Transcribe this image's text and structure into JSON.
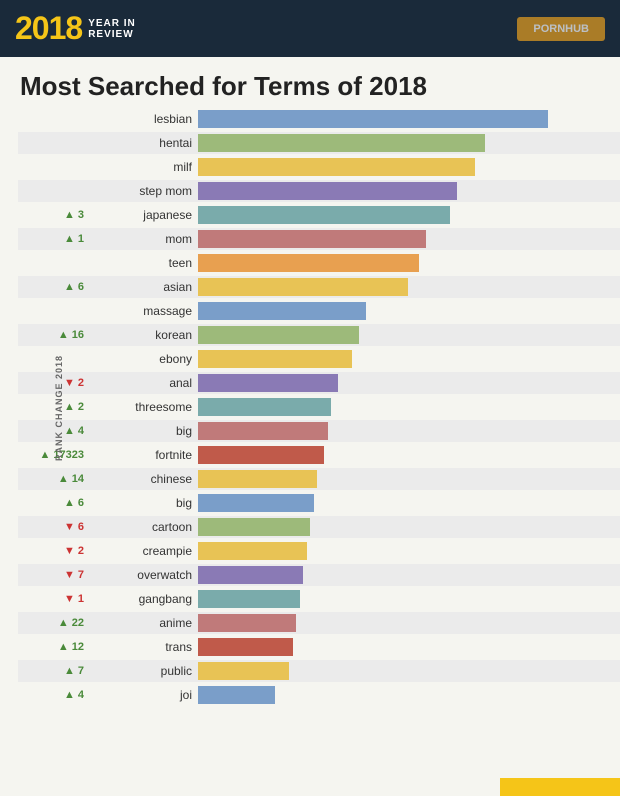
{
  "header": {
    "year": "2018",
    "tagline1": "YEAR IN",
    "tagline2": "REVIEW",
    "button_label": "PORNHUB"
  },
  "title": "Most Searched for Terms of 2018",
  "y_axis_label": "RANK CHANGE 2018",
  "bars": [
    {
      "label": "lesbian",
      "rank_change": "",
      "direction": "none",
      "value": 100,
      "color": "#7a9ec9"
    },
    {
      "label": "hentai",
      "rank_change": "",
      "direction": "none",
      "value": 82,
      "color": "#9dba7a"
    },
    {
      "label": "milf",
      "rank_change": "",
      "direction": "none",
      "value": 79,
      "color": "#e8c355"
    },
    {
      "label": "step mom",
      "rank_change": "",
      "direction": "none",
      "value": 74,
      "color": "#8a7ab5"
    },
    {
      "label": "japanese",
      "rank_change": "3",
      "direction": "up",
      "value": 72,
      "color": "#7aabab"
    },
    {
      "label": "mom",
      "rank_change": "1",
      "direction": "up",
      "value": 65,
      "color": "#c07a7a"
    },
    {
      "label": "teen",
      "rank_change": "",
      "direction": "none",
      "value": 63,
      "color": "#e8a050"
    },
    {
      "label": "asian",
      "rank_change": "6",
      "direction": "up",
      "value": 60,
      "color": "#e8c355"
    },
    {
      "label": "massage",
      "rank_change": "",
      "direction": "none",
      "value": 48,
      "color": "#7a9ec9"
    },
    {
      "label": "korean",
      "rank_change": "16",
      "direction": "up",
      "value": 46,
      "color": "#9dba7a"
    },
    {
      "label": "ebony",
      "rank_change": "",
      "direction": "none",
      "value": 44,
      "color": "#e8c355"
    },
    {
      "label": "anal",
      "rank_change": "2",
      "direction": "down",
      "value": 40,
      "color": "#8a7ab5"
    },
    {
      "label": "threesome",
      "rank_change": "2",
      "direction": "up",
      "value": 38,
      "color": "#7aabab"
    },
    {
      "label": "big",
      "rank_change": "4",
      "direction": "up",
      "value": 37,
      "color": "#c07a7a"
    },
    {
      "label": "fortnite",
      "rank_change": "17323",
      "direction": "up",
      "value": 36,
      "color": "#c05a4a"
    },
    {
      "label": "chinese",
      "rank_change": "14",
      "direction": "up",
      "value": 34,
      "color": "#e8c355"
    },
    {
      "label": "big",
      "rank_change": "6",
      "direction": "up",
      "value": 33,
      "color": "#7a9ec9"
    },
    {
      "label": "cartoon",
      "rank_change": "6",
      "direction": "down",
      "value": 32,
      "color": "#9dba7a"
    },
    {
      "label": "creampie",
      "rank_change": "2",
      "direction": "down",
      "value": 31,
      "color": "#e8c355"
    },
    {
      "label": "overwatch",
      "rank_change": "7",
      "direction": "down",
      "value": 30,
      "color": "#8a7ab5"
    },
    {
      "label": "gangbang",
      "rank_change": "1",
      "direction": "down",
      "value": 29,
      "color": "#7aabab"
    },
    {
      "label": "anime",
      "rank_change": "22",
      "direction": "up",
      "value": 28,
      "color": "#c07a7a"
    },
    {
      "label": "trans",
      "rank_change": "12",
      "direction": "up",
      "value": 27,
      "color": "#c05a4a"
    },
    {
      "label": "public",
      "rank_change": "7",
      "direction": "up",
      "value": 26,
      "color": "#e8c355"
    },
    {
      "label": "joi",
      "rank_change": "4",
      "direction": "up",
      "value": 22,
      "color": "#7a9ec9"
    }
  ]
}
